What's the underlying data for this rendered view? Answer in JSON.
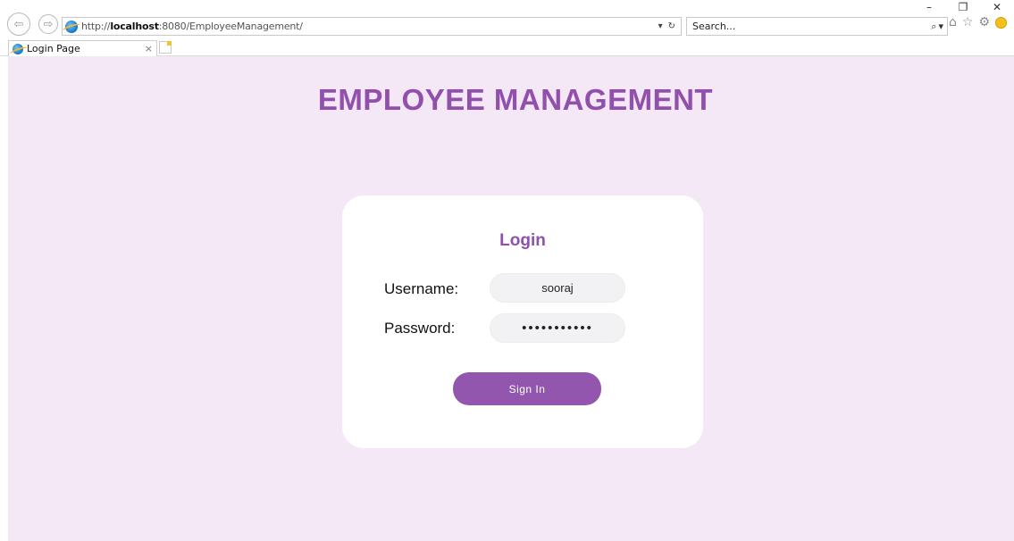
{
  "window": {
    "minimize_glyph": "–",
    "restore_glyph": "❐",
    "close_glyph": "✕"
  },
  "nav": {
    "back_glyph": "⇦",
    "forward_glyph": "⇨"
  },
  "address_bar": {
    "url_prefix": "http://",
    "url_host": "localhost",
    "url_rest": ":8080/EmployeeManagement/",
    "dropdown_glyph": "▾",
    "refresh_glyph": "↻"
  },
  "search_bar": {
    "placeholder": "Search...",
    "search_glyph": "⌕",
    "dropdown_glyph": "▾"
  },
  "toolbar": {
    "home_glyph": "⌂",
    "favorites_glyph": "☆",
    "settings_glyph": "⚙"
  },
  "tab": {
    "title": "Login Page",
    "close_glyph": "×"
  },
  "page": {
    "title": "EMPLOYEE MANAGEMENT",
    "background": "#f4e8f6",
    "accent": "#9050ab"
  },
  "login": {
    "heading": "Login",
    "username_label": "Username:",
    "username_value": "sooraj",
    "password_label": "Password:",
    "password_value": "•••••••••••",
    "button_label": "Sign In"
  }
}
